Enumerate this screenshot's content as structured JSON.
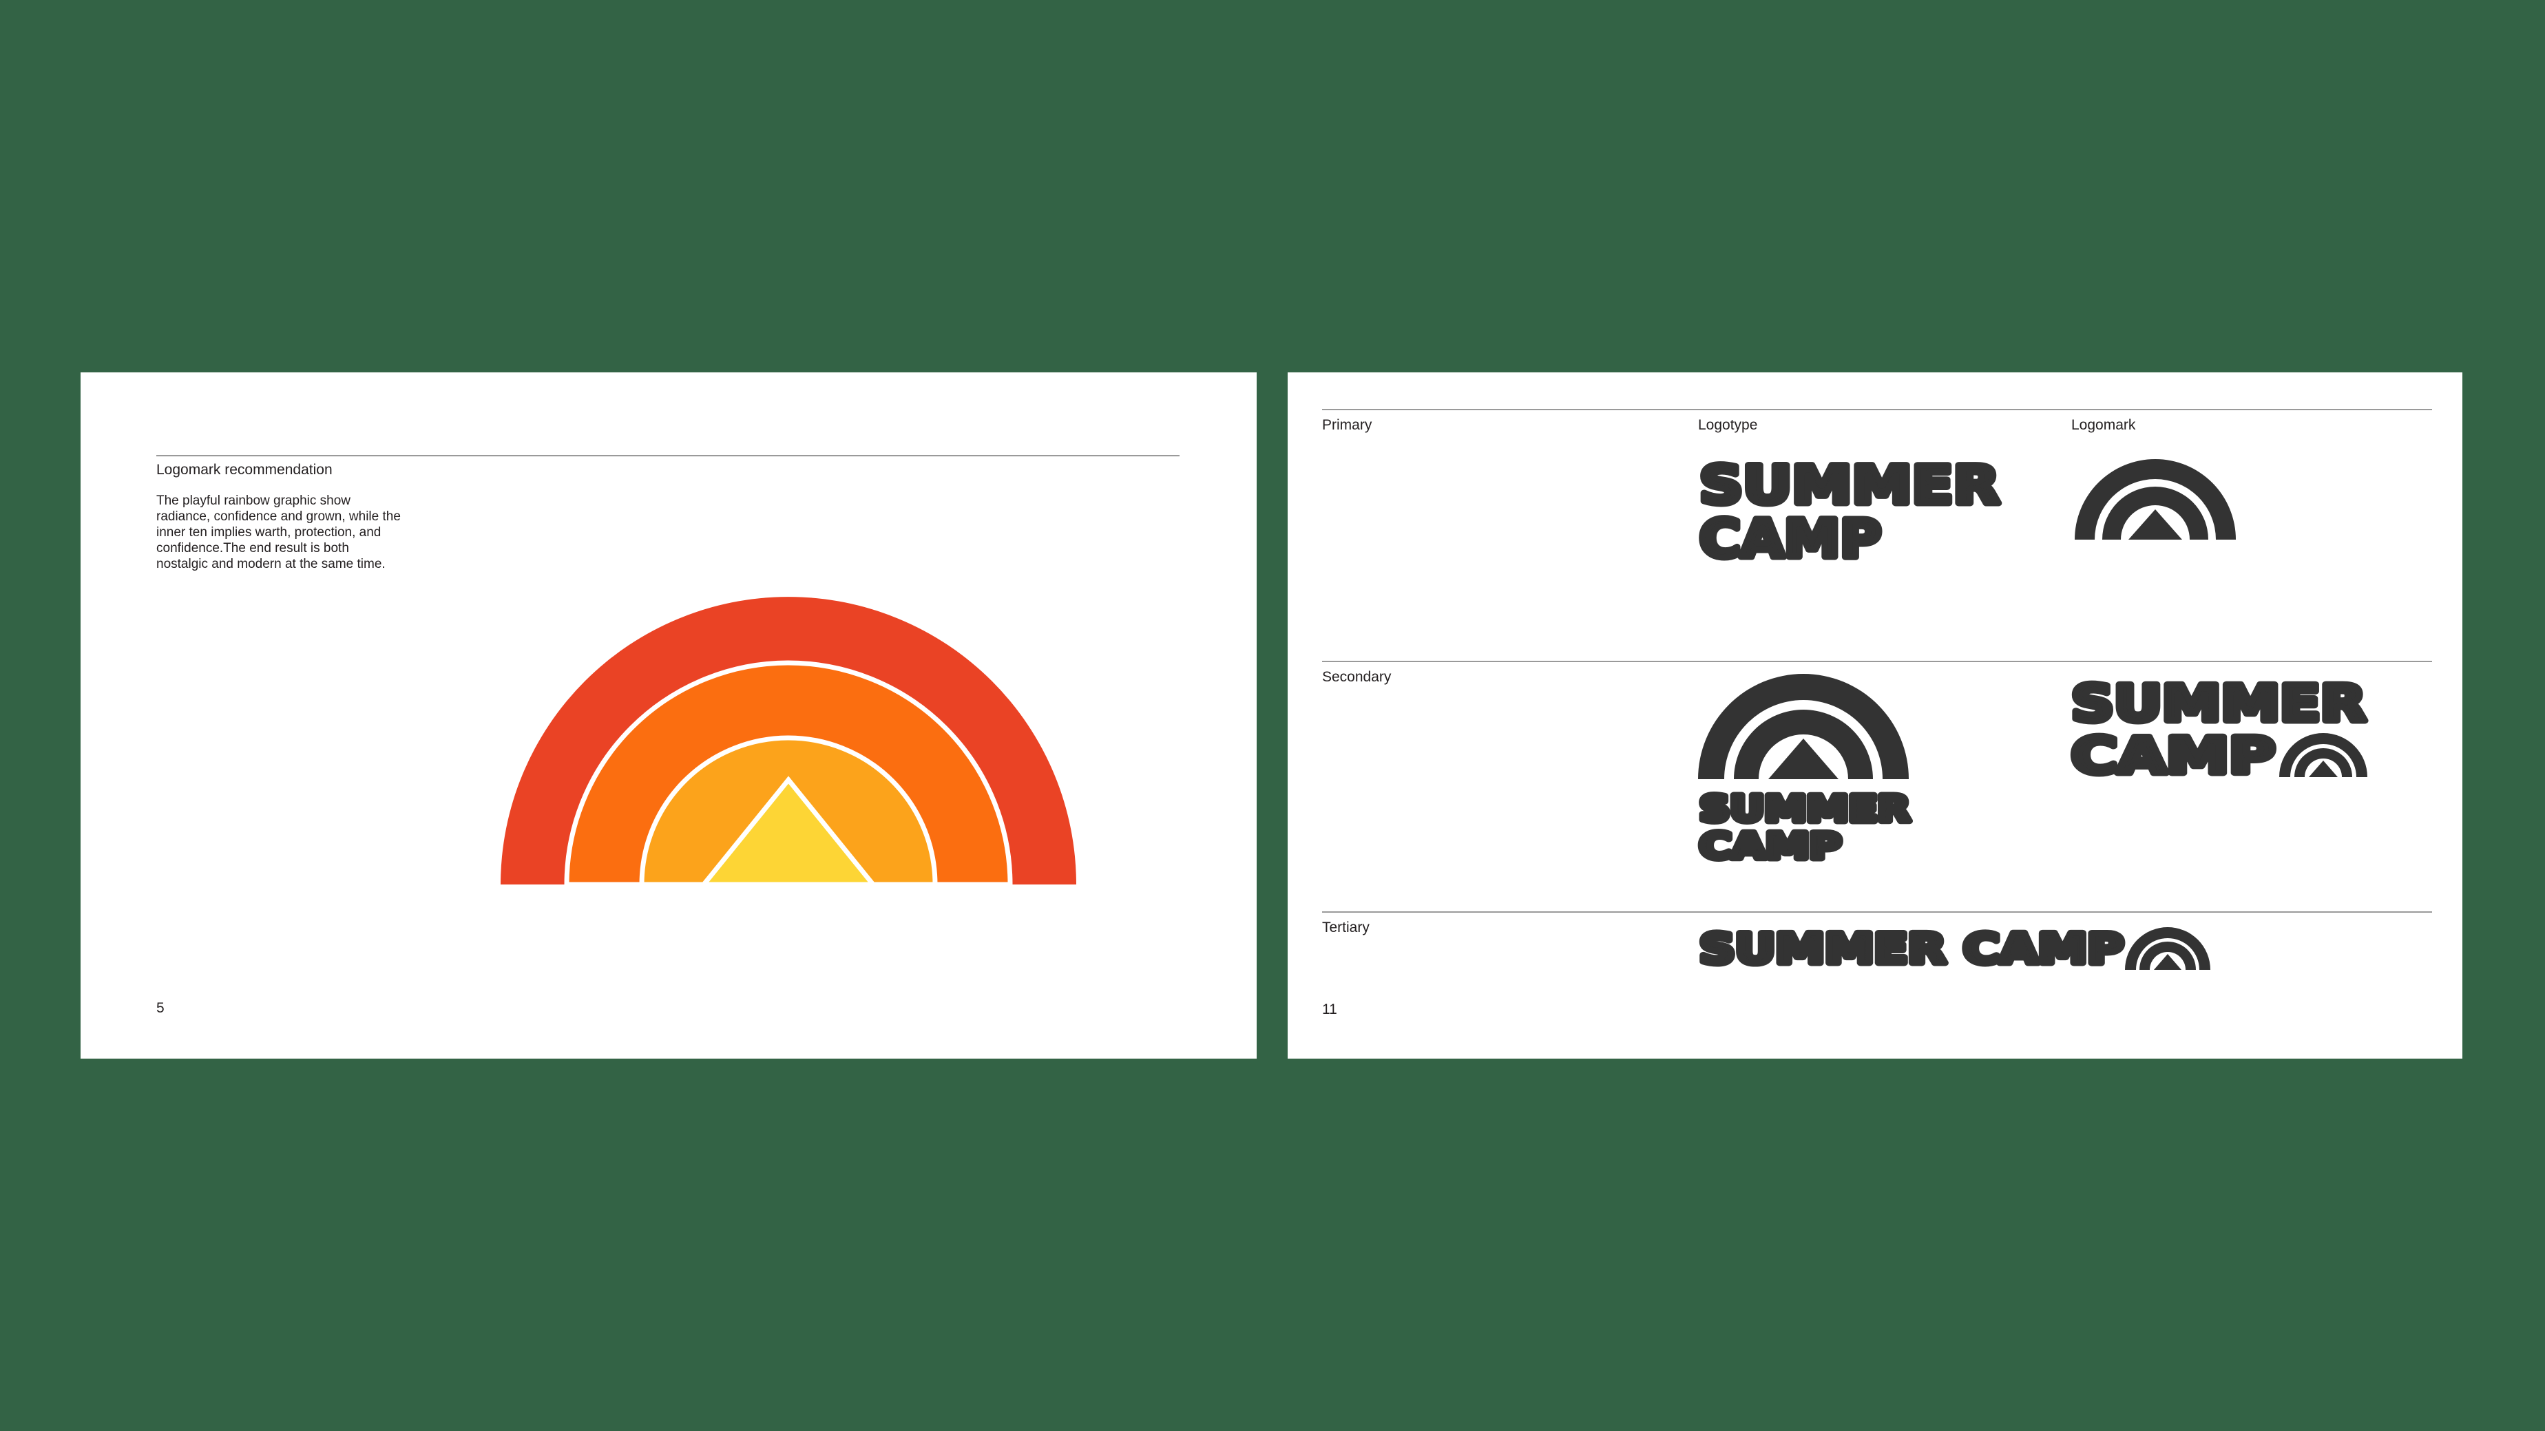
{
  "colors": {
    "background": "#336345",
    "page": "#ffffff",
    "rainbow_outer": "#ea4325",
    "rainbow_middle": "#fb6e10",
    "rainbow_inner": "#fca31b",
    "tent": "#fdd535",
    "mark_dark": "#333333"
  },
  "left_page": {
    "heading": "Logomark recommendation",
    "body": "The playful rainbow graphic show radiance, confidence and grown, while the inner ten implies warth, protection, and confidence.The end result is both nostalgic and modern at the same time.",
    "page_number": "5",
    "graphic_icon": "rainbow-tent-icon"
  },
  "right_page": {
    "rows": [
      {
        "label": "Primary"
      },
      {
        "label": "Secondary"
      },
      {
        "label": "Tertiary"
      }
    ],
    "columns": {
      "logotype": "Logotype",
      "logomark": "Logomark"
    },
    "wordmark": {
      "line1": "SUMMER",
      "line2": "CAMP",
      "single_line": "SUMMER CAMP"
    },
    "page_number": "11",
    "logomark_icon": "rainbow-tent-icon"
  }
}
